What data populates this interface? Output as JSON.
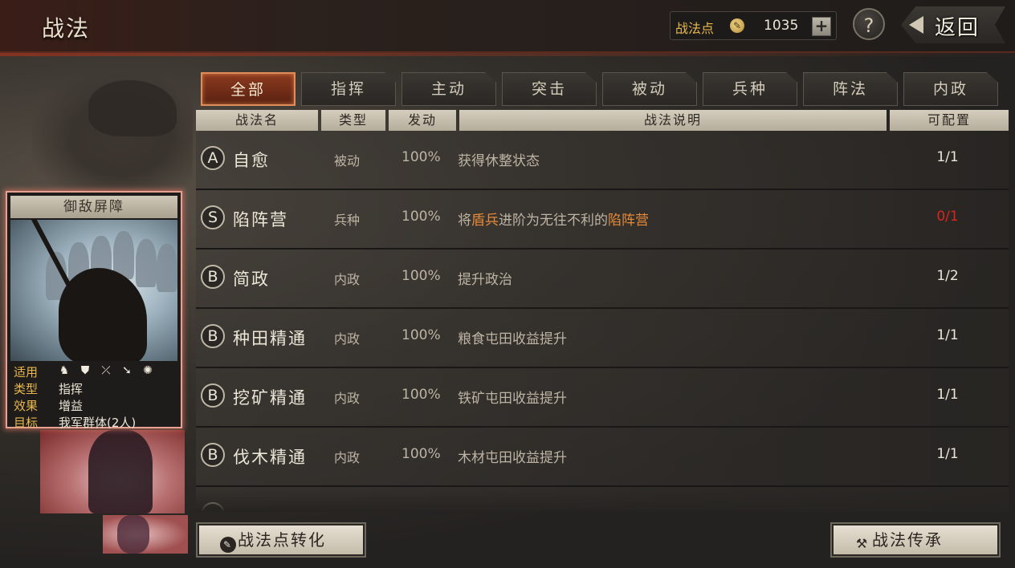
{
  "header": {
    "title": "战法",
    "points_label": "战法点",
    "points_value": "1035",
    "plus_label": "+",
    "help_label": "?",
    "back_label": "返回"
  },
  "tabs": [
    {
      "label": "全部",
      "active": true
    },
    {
      "label": "指挥"
    },
    {
      "label": "主动"
    },
    {
      "label": "突击"
    },
    {
      "label": "被动"
    },
    {
      "label": "兵种"
    },
    {
      "label": "阵法"
    },
    {
      "label": "内政"
    }
  ],
  "table": {
    "headers": [
      "战法名",
      "类型",
      "发动",
      "战法说明",
      "可配置"
    ],
    "rows": [
      {
        "grade": "A",
        "name": "自愈",
        "type": "被动",
        "rate": "100%",
        "desc": [
          {
            "t": "获得休整状态"
          }
        ],
        "config": "1/1",
        "config_red": false
      },
      {
        "grade": "S",
        "name": "陷阵营",
        "type": "兵种",
        "rate": "100%",
        "desc": [
          {
            "t": "将"
          },
          {
            "t": "盾兵",
            "hl": true
          },
          {
            "t": "进阶为无往不利的"
          },
          {
            "t": "陷阵营",
            "hl": true
          }
        ],
        "config": "0/1",
        "config_red": true
      },
      {
        "grade": "B",
        "name": "简政",
        "type": "内政",
        "rate": "100%",
        "desc": [
          {
            "t": "提升政治"
          }
        ],
        "config": "1/2",
        "config_red": false
      },
      {
        "grade": "B",
        "name": "种田精通",
        "type": "内政",
        "rate": "100%",
        "desc": [
          {
            "t": "粮食屯田收益提升"
          }
        ],
        "config": "1/1",
        "config_red": false
      },
      {
        "grade": "B",
        "name": "挖矿精通",
        "type": "内政",
        "rate": "100%",
        "desc": [
          {
            "t": "铁矿屯田收益提升"
          }
        ],
        "config": "1/1",
        "config_red": false
      },
      {
        "grade": "B",
        "name": "伐木精通",
        "type": "内政",
        "rate": "100%",
        "desc": [
          {
            "t": "木材屯田收益提升"
          }
        ],
        "config": "1/1",
        "config_red": false
      }
    ]
  },
  "card": {
    "title": "御敌屏障",
    "rows": [
      {
        "key": "适用",
        "icons": [
          "cavalry-icon",
          "shield-icon",
          "bow-icon",
          "spear-icon",
          "chariot-icon"
        ]
      },
      {
        "key": "类型",
        "value": "指挥"
      },
      {
        "key": "效果",
        "value": "增益"
      },
      {
        "key": "目标",
        "value": "我军群体(2人)"
      }
    ]
  },
  "footer": {
    "convert_label": "战法点转化",
    "inherit_label": "战法传承"
  },
  "colors": {
    "highlight": "#e58a3a",
    "config_warning": "#d8271e",
    "points_label": "#e8b84e"
  }
}
